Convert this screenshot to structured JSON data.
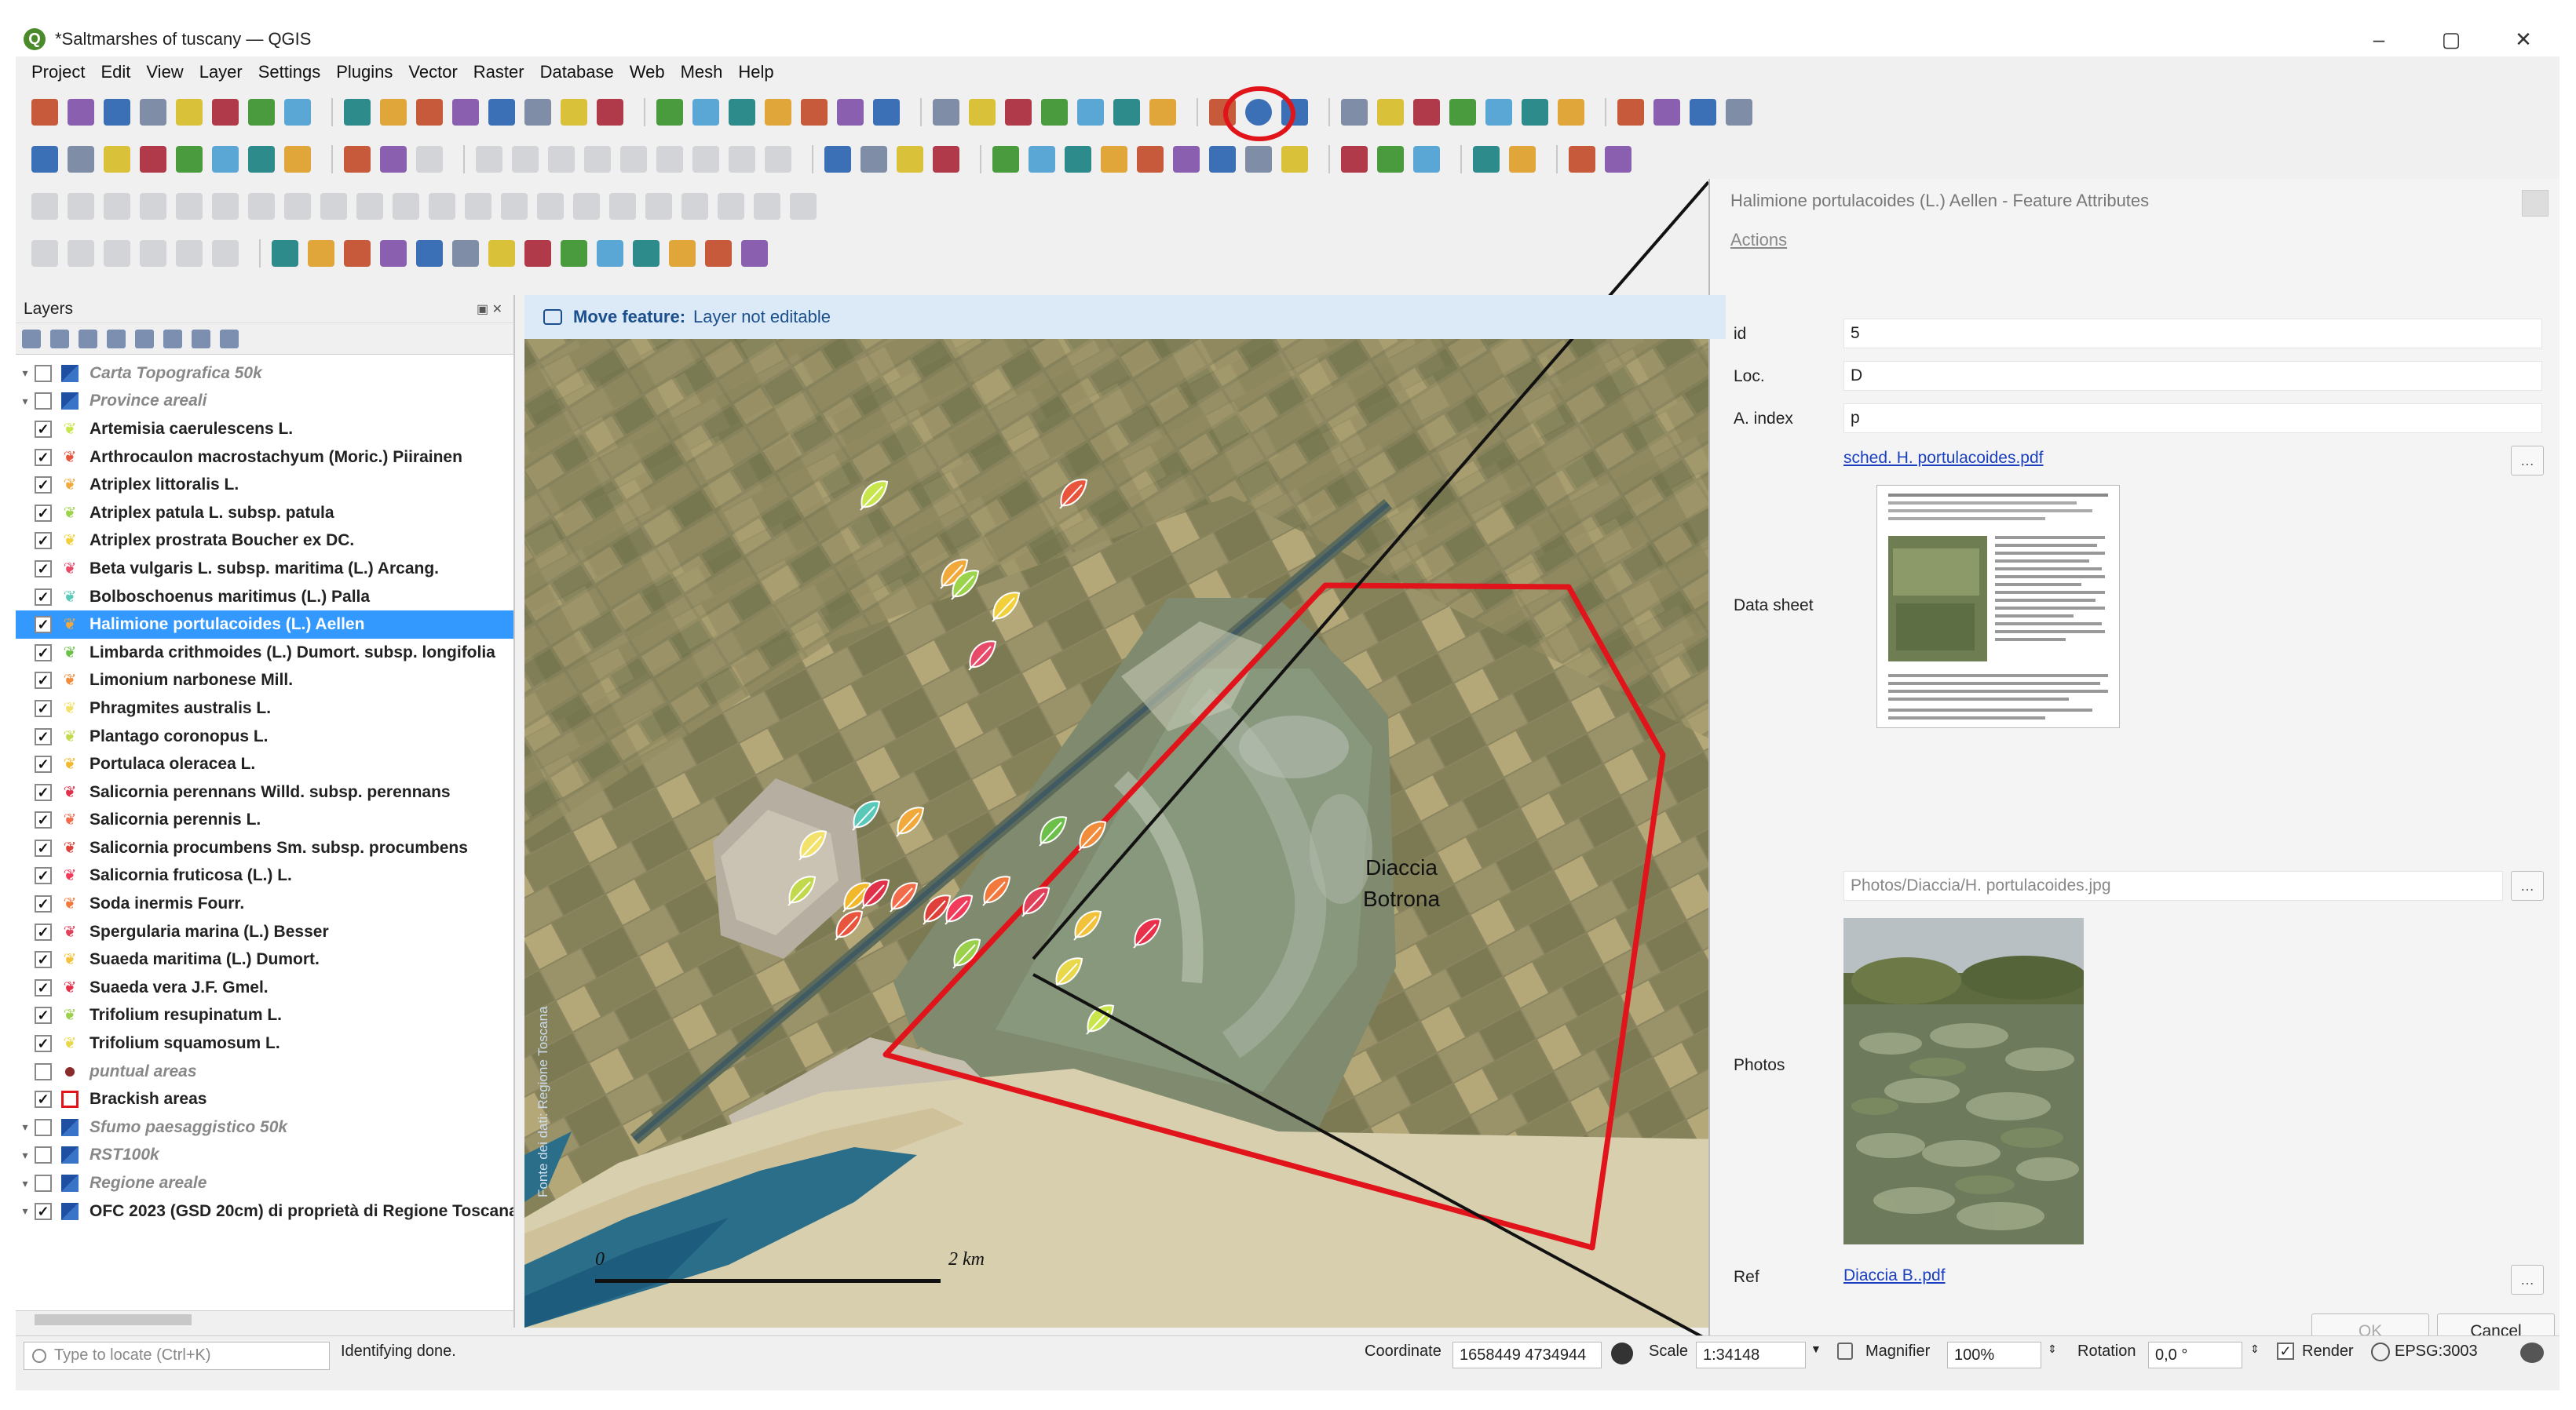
{
  "window": {
    "title": "*Saltmarshes of tuscany — QGIS",
    "logo": "Q",
    "minimize": "–",
    "maximize": "▢",
    "close": "✕"
  },
  "menu": [
    "Project",
    "Edit",
    "View",
    "Layer",
    "Settings",
    "Plugins",
    "Vector",
    "Raster",
    "Database",
    "Web",
    "Mesh",
    "Help"
  ],
  "layers_panel": {
    "title": "Layers",
    "items": [
      {
        "name": "Carta Topografica 50k",
        "checked": false,
        "style": "group",
        "expand": "▾",
        "symbol": "raster-icon"
      },
      {
        "name": "Province areali",
        "checked": false,
        "style": "group",
        "expand": "▾",
        "symbol": "raster-icon"
      },
      {
        "name": "Artemisia caerulescens L.",
        "checked": true,
        "style": "layer",
        "symbol_color": "#c8e64c"
      },
      {
        "name": "Arthrocaulon macrostachyum (Moric.) Piirainen",
        "checked": true,
        "style": "layer",
        "symbol_color": "#e8553c"
      },
      {
        "name": "Atriplex littoralis L.",
        "checked": true,
        "style": "layer",
        "symbol_color": "#f2a93b"
      },
      {
        "name": "Atriplex patula L. subsp. patula",
        "checked": true,
        "style": "layer",
        "symbol_color": "#9bd34a"
      },
      {
        "name": "Atriplex prostrata Boucher ex DC.",
        "checked": true,
        "style": "layer",
        "symbol_color": "#f2d03b"
      },
      {
        "name": "Beta vulgaris L. subsp. maritima (L.) Arcang.",
        "checked": true,
        "style": "layer",
        "symbol_color": "#e84a6a"
      },
      {
        "name": "Bolboschoenus maritimus (L.) Palla",
        "checked": true,
        "style": "layer",
        "symbol_color": "#58c9b9"
      },
      {
        "name": "Halimione portulacoides (L.) Aellen",
        "checked": true,
        "style": "selected",
        "symbol_color": "#f2a93b"
      },
      {
        "name": "Limbarda crithmoides (L.) Dumort. subsp. longifolia",
        "checked": true,
        "style": "layer",
        "symbol_color": "#6cc04a"
      },
      {
        "name": "Limonium narbonese Mill.",
        "checked": true,
        "style": "layer",
        "symbol_color": "#f28c3b"
      },
      {
        "name": "Phragmites australis L.",
        "checked": true,
        "style": "layer",
        "symbol_color": "#f2e26b"
      },
      {
        "name": "Plantago coronopus L.",
        "checked": true,
        "style": "layer",
        "symbol_color": "#c3d94c"
      },
      {
        "name": "Portulaca oleracea L.",
        "checked": true,
        "style": "layer",
        "symbol_color": "#f0b82a"
      },
      {
        "name": "Salicornia perennans Willd. subsp. perennans",
        "checked": true,
        "style": "layer",
        "symbol_color": "#e0304a"
      },
      {
        "name": "Salicornia perennis L.",
        "checked": true,
        "style": "layer",
        "symbol_color": "#f26b4a"
      },
      {
        "name": "Salicornia procumbens Sm. subsp. procumbens",
        "checked": true,
        "style": "layer",
        "symbol_color": "#e0403a"
      },
      {
        "name": "Salicornia fruticosa (L.) L.",
        "checked": true,
        "style": "layer",
        "symbol_color": "#f23a5a"
      },
      {
        "name": "Soda inermis Fourr.",
        "checked": true,
        "style": "layer",
        "symbol_color": "#f2783b"
      },
      {
        "name": "Spergularia marina (L.) Besser",
        "checked": true,
        "style": "layer",
        "symbol_color": "#e0405a"
      },
      {
        "name": "Suaeda maritima (L.) Dumort.",
        "checked": true,
        "style": "layer",
        "symbol_color": "#f2c23b"
      },
      {
        "name": "Suaeda vera J.F. Gmel.",
        "checked": true,
        "style": "layer",
        "symbol_color": "#e8304a"
      },
      {
        "name": "Trifolium resupinatum L.",
        "checked": true,
        "style": "layer",
        "symbol_color": "#9ad04a"
      },
      {
        "name": "Trifolium squamosum L.",
        "checked": true,
        "style": "layer",
        "symbol_color": "#e8d84a"
      },
      {
        "name": "puntual areas",
        "checked": false,
        "style": "disabled",
        "symbol_color": "#8b2a2a"
      },
      {
        "name": "Brackish areas",
        "checked": true,
        "style": "layer",
        "symbol_color": "#e0141a"
      },
      {
        "name": "Sfumo paesaggistico 50k",
        "checked": false,
        "style": "group",
        "expand": "▾",
        "symbol": "raster-icon"
      },
      {
        "name": "RST100k",
        "checked": false,
        "style": "group",
        "expand": "▾",
        "symbol": "raster-icon"
      },
      {
        "name": "Regione areale",
        "checked": false,
        "style": "group",
        "expand": "▾",
        "symbol": "raster-icon"
      },
      {
        "name": "OFC 2023 (GSD 20cm) di proprietà di  Regione Toscana",
        "checked": true,
        "style": "group-on",
        "expand": "▾",
        "symbol": "raster-icon"
      }
    ]
  },
  "map": {
    "message_label": "Move feature:",
    "message_text": "Layer not editable",
    "area_label_line1": "Diaccia",
    "area_label_line2": "Botrona",
    "scale_start": "0",
    "scale_end": "2 km",
    "credit": "Fonte dei dati: Regione Toscana"
  },
  "dialog": {
    "title": "Halimione portulacoides (L.) Aellen - Feature Attributes",
    "actions": "Actions",
    "fields": {
      "id_label": "id",
      "id_value": "5",
      "loc_label": "Loc.",
      "loc_value": "D",
      "aindex_label": "A. index",
      "aindex_value": "p",
      "sched_link": "sched. H. portulacoides.pdf",
      "datasheet_label": "Data sheet",
      "photo_path": "Photos/Diaccia/H. portulacoides.jpg",
      "photos_label": "Photos",
      "ref_label": "Ref",
      "ref_link": "Diaccia B..pdf"
    },
    "browse_btn": "…",
    "ok": "OK",
    "cancel": "Cancel"
  },
  "statusbar": {
    "locate_placeholder": "Type to locate (Ctrl+K)",
    "status_text": "Identifying done.",
    "coordinate_label": "Coordinate",
    "coordinate_value": "1658449 4734944",
    "scale_label": "Scale",
    "scale_value": "1:34148",
    "magnifier_label": "Magnifier",
    "magnifier_value": "100%",
    "rotation_label": "Rotation",
    "rotation_value": "0,0 °",
    "render_label": "Render",
    "crs": "EPSG:3003"
  }
}
